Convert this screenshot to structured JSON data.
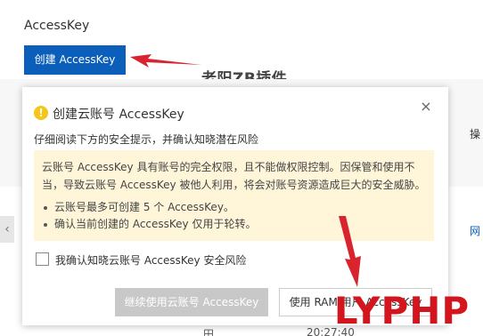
{
  "page": {
    "title": "AccessKey",
    "create_button": "创建 AccessKey",
    "watermark": "老阳ZB插件",
    "side_text_1": "操",
    "side_text_2": "网",
    "bottom_text_1": "田",
    "bottom_text_2": "20:27:40",
    "left_scroll": "‹"
  },
  "dialog": {
    "title": "创建云账号 AccessKey",
    "description": "仔细阅读下方的安全提示，并确认知晓潜在风险",
    "warning_paragraph": "云账号 AccessKey 具有账号的完全权限，且不能做权限控制。因保管和使用不当，导致云账号 AccessKey 被他人利用，将会对账号资源造成巨大的安全威胁。",
    "warning_items": [
      "云账号最多可创建 5 个 AccessKey。",
      "确认当前创建的 AccessKey 仅用于轮转。"
    ],
    "checkbox_label": "我确认知晓云账号 AccessKey 安全风险",
    "continue_button": "继续使用云账号 AccessKey",
    "ram_button": "使用 RAM 用户 AccessKey",
    "close_icon": "close-icon",
    "warning_icon": "warning-circle-icon"
  },
  "branding": {
    "logo_text": "LYPHP"
  },
  "colors": {
    "primary": "#0b5fbb",
    "warning_bg": "#fff6da",
    "warning_icon": "#f5c518",
    "disabled_button": "#c8c8c8",
    "annotation_arrow": "#d9242f",
    "logo": "#d3161e"
  }
}
